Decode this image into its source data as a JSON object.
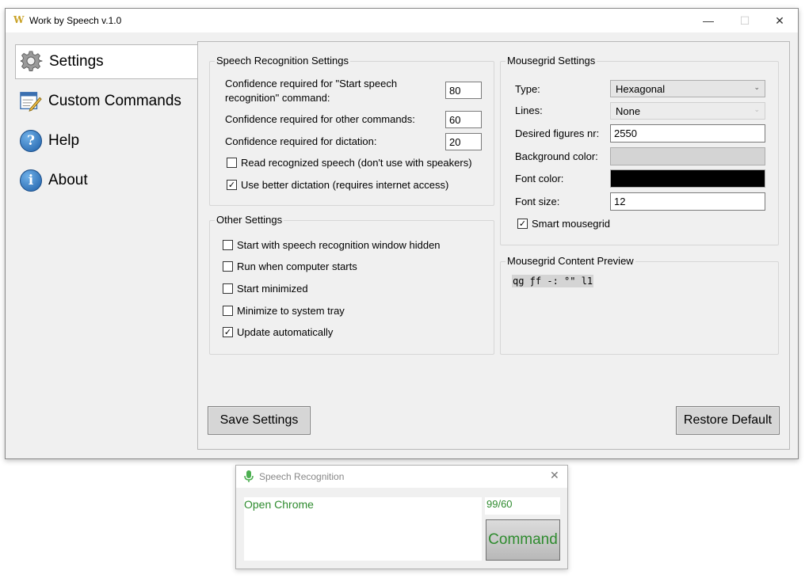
{
  "app": {
    "logo_text": "W",
    "title": "Work by Speech v.1.0",
    "window_controls": {
      "minimize": "—",
      "maximize": "☐",
      "close": "✕"
    }
  },
  "sidebar": {
    "items": [
      {
        "label": "Settings",
        "icon": "gear-icon",
        "active": true
      },
      {
        "label": "Custom Commands",
        "icon": "edit-commands-icon",
        "active": false
      },
      {
        "label": "Help",
        "icon": "help-icon",
        "icon_glyph": "?",
        "active": false
      },
      {
        "label": "About",
        "icon": "info-icon",
        "icon_glyph": "i",
        "active": false
      }
    ]
  },
  "speech_settings": {
    "title": "Speech Recognition Settings",
    "start_conf_label": "Confidence required for \"Start speech recognition\" command:",
    "start_conf_value": "80",
    "other_conf_label": "Confidence required for other commands:",
    "other_conf_value": "60",
    "dictation_conf_label": "Confidence required for dictation:",
    "dictation_conf_value": "20",
    "read_recognized_label": "Read recognized speech (don't use with speakers)",
    "read_recognized_checked": false,
    "better_dictation_label": "Use better dictation (requires internet access)",
    "better_dictation_checked": true
  },
  "other_settings": {
    "title": "Other Settings",
    "items": [
      {
        "label": "Start with speech recognition window hidden",
        "checked": false
      },
      {
        "label": "Run when computer starts",
        "checked": false
      },
      {
        "label": "Start minimized",
        "checked": false
      },
      {
        "label": "Minimize to system tray",
        "checked": false
      },
      {
        "label": "Update automatically",
        "checked": true
      }
    ]
  },
  "mousegrid": {
    "title": "Mousegrid Settings",
    "type_label": "Type:",
    "type_value": "Hexagonal",
    "lines_label": "Lines:",
    "lines_value": "None",
    "figures_label": "Desired figures nr:",
    "figures_value": "2550",
    "bg_color_label": "Background color:",
    "bg_color": "#d4d4d4",
    "font_color_label": "Font color:",
    "font_color": "#000000",
    "font_size_label": "Font size:",
    "font_size_value": "12",
    "smart_label": "Smart mousegrid",
    "smart_checked": true
  },
  "preview": {
    "title": "Mousegrid Content Preview",
    "sample": "qg ƒf -: °\" l1"
  },
  "buttons": {
    "save": "Save Settings",
    "restore": "Restore Default"
  },
  "speech_window": {
    "title": "Speech Recognition",
    "icon": "microphone-icon",
    "recognized_text": "Open Chrome",
    "score": "99/60",
    "mode": "Command",
    "accent": "#2e8b2e"
  }
}
